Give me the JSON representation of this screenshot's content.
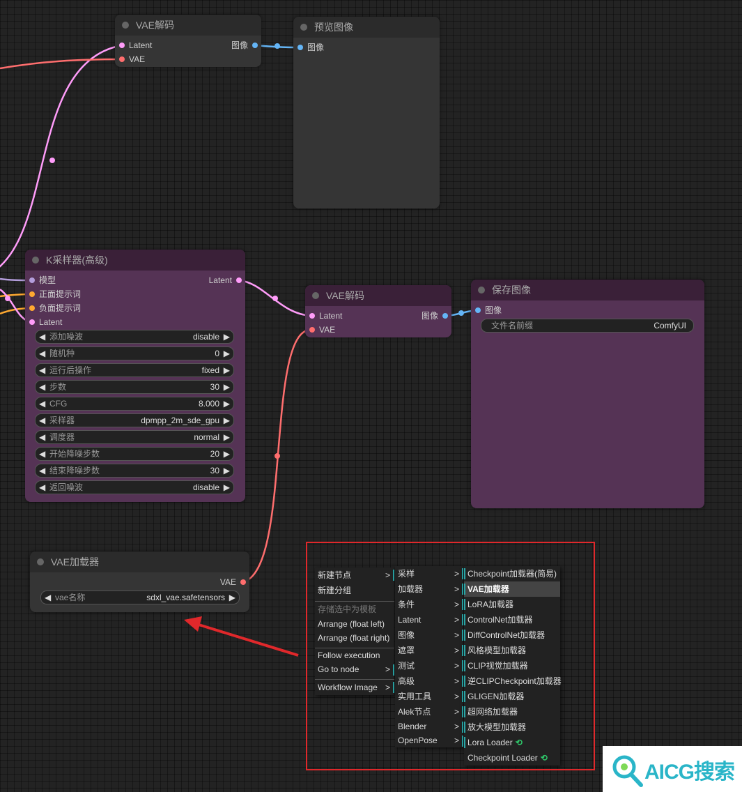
{
  "colors": {
    "latent": "#ff9cf9",
    "vae": "#ff6e6e",
    "image": "#64b5f6",
    "model": "#b39ddb",
    "conditioning": "#ffa931",
    "node_gray": "#353535",
    "node_purple": "#553355",
    "highlight": "#e0282b",
    "submenu_bar": "#2aa5a5",
    "watermark": "#2ab5c8"
  },
  "vae_decode_top": {
    "title": "VAE解码",
    "inputs": [
      "Latent",
      "VAE"
    ],
    "output": "图像"
  },
  "preview_image": {
    "title": "预览图像",
    "input": "图像"
  },
  "ksampler": {
    "title": "K采样器(高级)",
    "inputs": [
      "模型",
      "正面提示词",
      "负面提示词",
      "Latent"
    ],
    "output": "Latent",
    "widgets": [
      {
        "label": "添加噪波",
        "value": "disable"
      },
      {
        "label": "随机种",
        "value": "0"
      },
      {
        "label": "运行后操作",
        "value": "fixed"
      },
      {
        "label": "步数",
        "value": "30"
      },
      {
        "label": "CFG",
        "value": "8.000"
      },
      {
        "label": "采样器",
        "value": "dpmpp_2m_sde_gpu"
      },
      {
        "label": "调度器",
        "value": "normal"
      },
      {
        "label": "开始降噪步数",
        "value": "20"
      },
      {
        "label": "结束降噪步数",
        "value": "30"
      },
      {
        "label": "返回噪波",
        "value": "disable"
      }
    ]
  },
  "vae_decode_mid": {
    "title": "VAE解码",
    "inputs": [
      "Latent",
      "VAE"
    ],
    "output": "图像"
  },
  "save_image": {
    "title": "保存图像",
    "input": "图像",
    "widget": {
      "label": "文件名前缀",
      "value": "ComfyUI"
    }
  },
  "vae_loader": {
    "title": "VAE加载器",
    "output": "VAE",
    "widget": {
      "label": "vae名称",
      "value": "sdxl_vae.safetensors"
    }
  },
  "context_menu": {
    "items": [
      {
        "label": "新建节点",
        "submenu": true
      },
      {
        "label": "新建分组"
      },
      {
        "label": "存储选中为模板",
        "disabled": true,
        "separator": true
      },
      {
        "label": "Arrange (float left)"
      },
      {
        "label": "Arrange (float right)"
      },
      {
        "label": "Follow execution",
        "separator": true
      },
      {
        "label": "Go to node",
        "submenu": true
      },
      {
        "label": "Workflow Image",
        "submenu": true,
        "separator": true
      }
    ]
  },
  "submenu_categories": [
    "采样",
    "加载器",
    "条件",
    "Latent",
    "图像",
    "遮罩",
    "测试",
    "高级",
    "实用工具",
    "Alek节点",
    "Blender",
    "OpenPose"
  ],
  "loader_items": [
    {
      "label": "Checkpoint加载器(简易)"
    },
    {
      "label": "VAE加载器",
      "highlighted": true
    },
    {
      "label": "LoRA加载器"
    },
    {
      "label": "ControlNet加载器"
    },
    {
      "label": "DiffControlNet加载器"
    },
    {
      "label": "风格模型加载器"
    },
    {
      "label": "CLIP视觉加载器"
    },
    {
      "label": "逆CLIPCheckpoint加载器"
    },
    {
      "label": "GLIGEN加载器"
    },
    {
      "label": "超网络加载器"
    },
    {
      "label": "放大模型加载器"
    },
    {
      "label": "Lora Loader",
      "badge": "link-icon"
    },
    {
      "label": "Checkpoint Loader",
      "badge": "link-icon"
    }
  ],
  "watermark": {
    "text": "AICG搜索"
  }
}
